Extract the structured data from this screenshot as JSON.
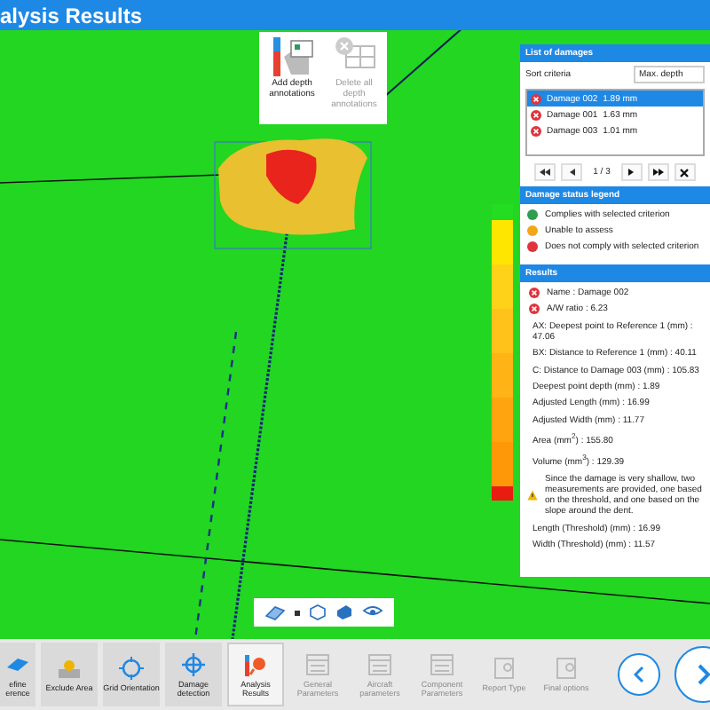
{
  "window": {
    "title": "alysis Results"
  },
  "annotation_tools": [
    {
      "label": "Add depth annotations",
      "disabled": false
    },
    {
      "label": "Delete all depth annotations",
      "disabled": true
    }
  ],
  "damage_list": {
    "title": "List of damages",
    "sort_label": "Sort criteria",
    "sort_value": "Max. depth",
    "items": [
      {
        "name": "Damage 002",
        "value": "1.89 mm",
        "selected": true
      },
      {
        "name": "Damage 001",
        "value": "1.63 mm",
        "selected": false
      },
      {
        "name": "Damage 003",
        "value": "1.01 mm",
        "selected": false
      }
    ],
    "page": "1 / 3"
  },
  "legend": {
    "title": "Damage status legend",
    "items": [
      {
        "label": "Complies with selected criterion",
        "color": "#2e9e4f"
      },
      {
        "label": "Unable to assess",
        "color": "#f0a818"
      },
      {
        "label": "Does not comply with selected criterion",
        "color": "#e0343c"
      }
    ]
  },
  "results": {
    "title": "Results",
    "entries": [
      {
        "kind": "error",
        "text": "Name : Damage 002"
      },
      {
        "kind": "error",
        "text": "A/W ratio : 6.23"
      },
      {
        "kind": "plain",
        "text": "AX: Deepest point to Reference 1 (mm) : 47.06"
      },
      {
        "kind": "plain",
        "text": "BX: Distance to Reference 1 (mm) : 40.11"
      },
      {
        "kind": "plain",
        "text": "C: Distance to Damage 003 (mm) : 105.83"
      },
      {
        "kind": "plain",
        "text": "Deepest point depth (mm) : 1.89"
      },
      {
        "kind": "plain",
        "text": "Adjusted Length (mm) : 16.99"
      },
      {
        "kind": "plain",
        "text": "Adjusted Width (mm) : 11.77"
      },
      {
        "kind": "plain",
        "text": "Area (mm$^{2}$) : 155.80"
      },
      {
        "kind": "plain",
        "text": "Volume (mm$^{3}$) : 129.39"
      },
      {
        "kind": "warning",
        "text": "Since the damage is very shallow, two measurements are provided, one based on the threshold, and one based on the slope around the dent."
      },
      {
        "kind": "plain",
        "text": "Length (Threshold) (mm) : 16.99"
      },
      {
        "kind": "plain",
        "text": "Width (Threshold) (mm) : 11.57"
      }
    ]
  },
  "steps": [
    {
      "label": "efine erence",
      "selected": false,
      "disabled": false
    },
    {
      "label": "Exclude Area",
      "selected": false,
      "disabled": false
    },
    {
      "label": "Grid Orientation",
      "selected": false,
      "disabled": false
    },
    {
      "label": "Damage detection",
      "selected": false,
      "disabled": false
    },
    {
      "label": "Analysis Results",
      "selected": true,
      "disabled": false
    },
    {
      "label": "General Parameters",
      "selected": false,
      "disabled": true
    },
    {
      "label": "Aircraft parameters",
      "selected": false,
      "disabled": true
    },
    {
      "label": "Component Parameters",
      "selected": false,
      "disabled": true
    },
    {
      "label": "Report Type",
      "selected": false,
      "disabled": true
    },
    {
      "label": "Final options",
      "selected": false,
      "disabled": true
    }
  ]
}
